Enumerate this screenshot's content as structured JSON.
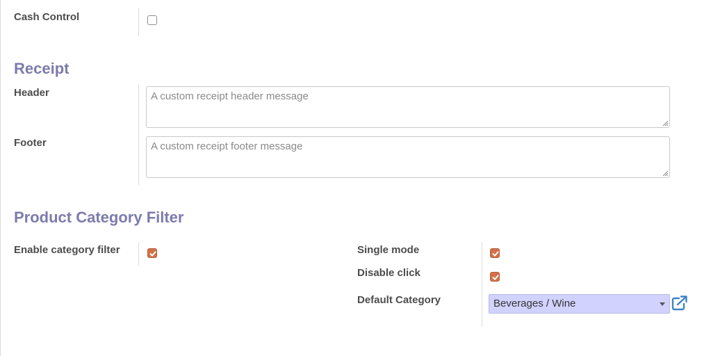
{
  "cash_control": {
    "label": "Cash Control",
    "checked": false
  },
  "receipt": {
    "title": "Receipt",
    "header": {
      "label": "Header",
      "placeholder": "A custom receipt header message"
    },
    "footer": {
      "label": "Footer",
      "placeholder": "A custom receipt footer message"
    }
  },
  "product_category_filter": {
    "title": "Product Category Filter",
    "enable_category_filter": {
      "label": "Enable category filter",
      "checked": true
    },
    "single_mode": {
      "label": "Single mode",
      "checked": true
    },
    "disable_click": {
      "label": "Disable click",
      "checked": true
    },
    "default_category": {
      "label": "Default Category",
      "value": "Beverages / Wine"
    }
  },
  "icons": {
    "checkbox_check": "check-icon",
    "select_caret": "caret-down-icon",
    "external": "external-link-icon"
  },
  "colors": {
    "section_title": "#7c7bad",
    "checkbox_checked": "#d2714a",
    "select_bg": "#d2d2ff",
    "link": "#3d83c4"
  }
}
